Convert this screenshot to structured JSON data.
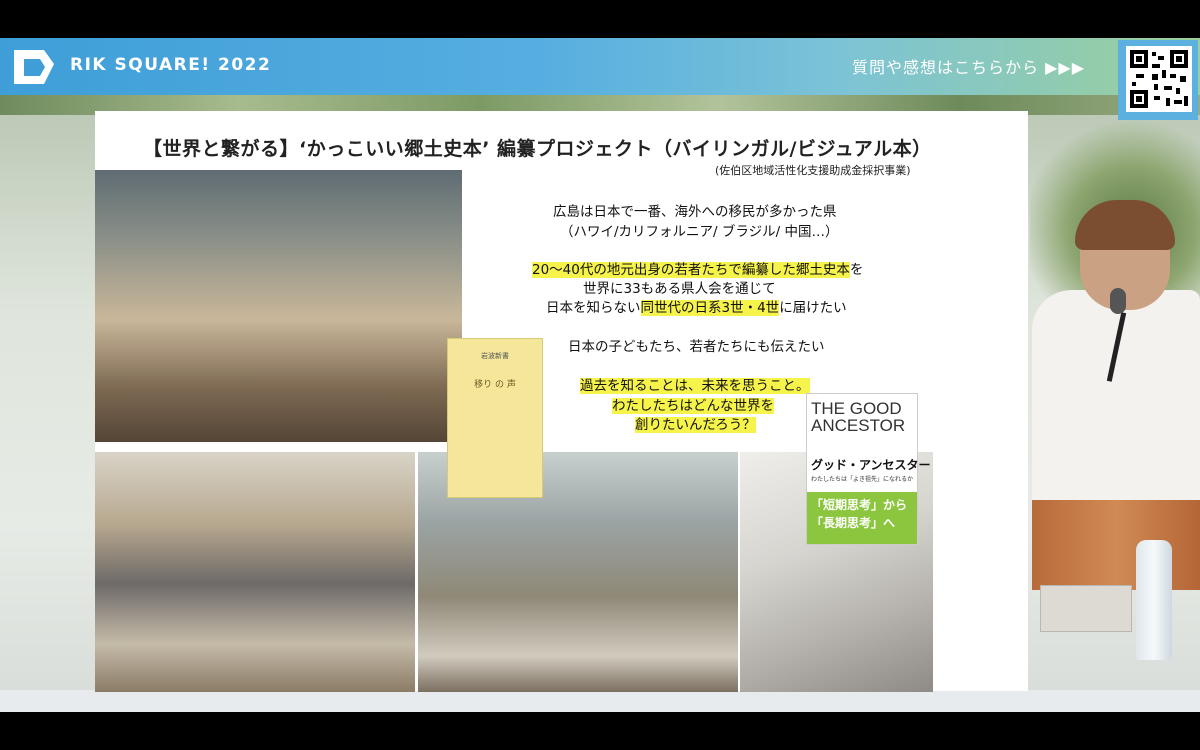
{
  "header": {
    "brand": "RIK SQUARE! 2022",
    "cta": "質問や感想はこちらから ▶▶▶"
  },
  "icons": {
    "logo": "rik-logo-icon",
    "qr": "qr-code-icon"
  },
  "slide": {
    "title": "【世界と繋がる】‘かっこいい郷土史本’ 編纂プロジェクト（バイリンガル/ビジュアル本）",
    "subtitle": "(佐伯区地域活性化支援助成金採択事業)",
    "messages": [
      "広島は日本で一番、海外への移民が多かった県",
      "（ハワイ/カリフォルニア/ ブラジル/ 中国…）",
      "20〜40代の地元出身の若者たちで編纂した郷土史本",
      "を",
      "世界に33もある県人会を通じて",
      "日本を知らない",
      "同世代の日系3世・4世",
      "に届けたい",
      "日本の子どもたち、若者たちにも伝えたい",
      "過去を知ることは、未来を思うこと。",
      "わたしたちはどんな世界を",
      "創りたいんだろう？"
    ],
    "book1": {
      "series": "岩波新書",
      "title": "移り の 声"
    },
    "book2": {
      "title": "THE GOOD ANCESTOR",
      "jp_title": "グッド・アンセスター",
      "small": "わたしたちは「よき祖先」になれるか",
      "band1": "「短期思考」から",
      "band2": "「長期思考」へ"
    }
  },
  "colors": {
    "highlight": "#f6f34a",
    "header_blue": "#3f9ed8",
    "header_green": "#9bd09a"
  }
}
